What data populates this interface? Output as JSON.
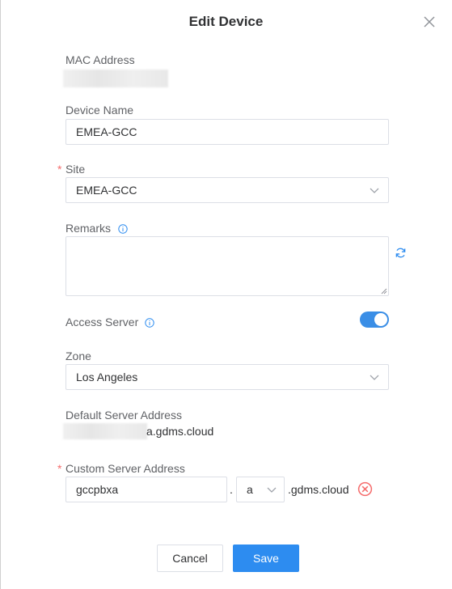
{
  "dialog": {
    "title": "Edit Device"
  },
  "fields": {
    "mac": {
      "label": "MAC Address"
    },
    "device_name": {
      "label": "Device Name",
      "value": "EMEA-GCC"
    },
    "site": {
      "label": "Site",
      "value": "EMEA-GCC",
      "required": "*"
    },
    "remarks": {
      "label": "Remarks"
    },
    "access_server": {
      "label": "Access Server",
      "enabled": true
    },
    "zone": {
      "label": "Zone",
      "value": "Los Angeles"
    },
    "default_server": {
      "label": "Default Server Address",
      "value_suffix": "a.gdms.cloud"
    },
    "custom_server": {
      "label": "Custom Server Address",
      "required": "*",
      "prefix": "gccpbxa",
      "dot": ".",
      "select": "a",
      "suffix": ".gdms.cloud"
    }
  },
  "buttons": {
    "cancel": "Cancel",
    "save": "Save"
  },
  "icons": {
    "close": "close-icon",
    "info": "info-icon",
    "refresh": "refresh-icon",
    "chevron": "chevron-down-icon",
    "clear": "clear-circle-icon"
  },
  "colors": {
    "accent": "#2d8cf0",
    "required": "#f56c6c",
    "error": "#f56c6c"
  }
}
